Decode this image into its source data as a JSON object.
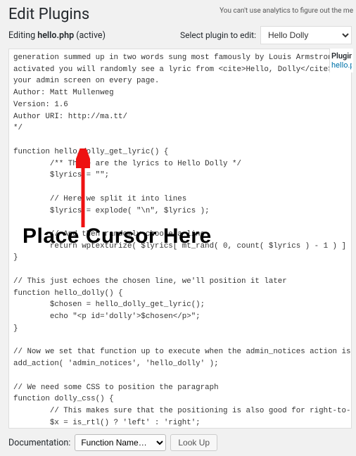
{
  "top_notice": "You can't use analytics to figure out the me",
  "page_title": "Edit Plugins",
  "editing": {
    "prefix": "Editing ",
    "file": "hello.php",
    "status": " (active)"
  },
  "select_plugin": {
    "label": "Select plugin to edit:",
    "selected": "Hello Dolly"
  },
  "side_panel": {
    "heading": "Plugin F",
    "link": "hello.ph"
  },
  "overlay_text": "Place Cursor Here",
  "documentation": {
    "label": "Documentation:",
    "placeholder": "Function Name…",
    "button": "Look Up"
  },
  "code": "generation summed up in two words sung most famously by Louis Armstrong: Hello, Dolly. When\nactivated you will randomly see a lyric from <cite>Hello, Dolly</cite> in the upper right of\nyour admin screen on every page.\nAuthor: Matt Mullenweg\nVersion: 1.6\nAuthor URI: http://ma.tt/\n*/\n\nfunction hello_dolly_get_lyric() {\n        /** These are the lyrics to Hello Dolly */\n        $lyrics = \"\";\n\n        // Here we split it into lines\n        $lyrics = explode( \"\\n\", $lyrics );\n\n        // And then randomly choose a line\n        return wptexturize( $lyrics[ mt_rand( 0, count( $lyrics ) - 1 ) ] );\n}\n\n// This just echoes the chosen line, we'll position it later\nfunction hello_dolly() {\n        $chosen = hello_dolly_get_lyric();\n        echo \"<p id='dolly'>$chosen</p>\";\n}\n\n// Now we set that function up to execute when the admin_notices action is called\nadd_action( 'admin_notices', 'hello_dolly' );\n\n// We need some CSS to position the paragraph\nfunction dolly_css() {\n        // This makes sure that the positioning is also good for right-to-left languages\n        $x = is_rtl() ? 'left' : 'right';\n\n        echo \"\n        <style type='text/css'>\n        #dolly {\n                float: $x;\n                padding-$x: 15px;\n                padding-top: 5px;\n                margin: 0;"
}
